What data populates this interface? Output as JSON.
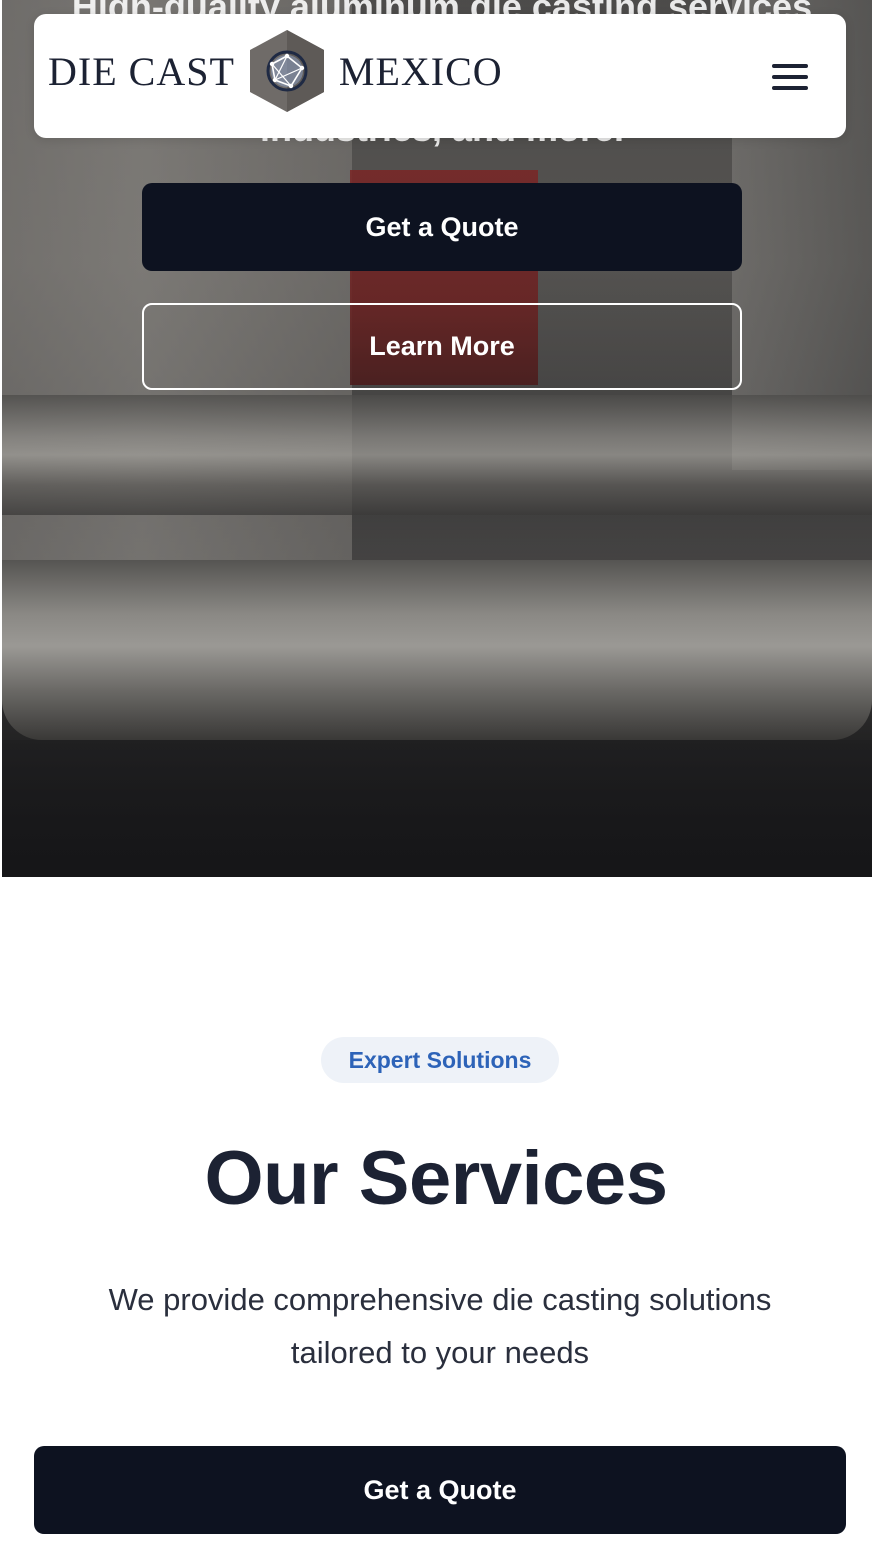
{
  "hero": {
    "text_line_1": "High-quality aluminum die casting services for",
    "text_line_2": "industries, and more.",
    "quote_button": "Get a Quote",
    "learn_button": "Learn More"
  },
  "header": {
    "logo_left": "DIE CAST",
    "logo_right": "MEXICO",
    "menu_icon": "hamburger-menu-icon"
  },
  "services": {
    "badge": "Expert Solutions",
    "title": "Our Services",
    "subtitle": "We provide comprehensive die casting solutions tailored to your needs",
    "quote_button": "Get a Quote"
  },
  "colors": {
    "button_dark": "#0d1220",
    "heading": "#1c2233",
    "badge_text": "#2d63b8",
    "badge_bg": "#eef2f8"
  }
}
